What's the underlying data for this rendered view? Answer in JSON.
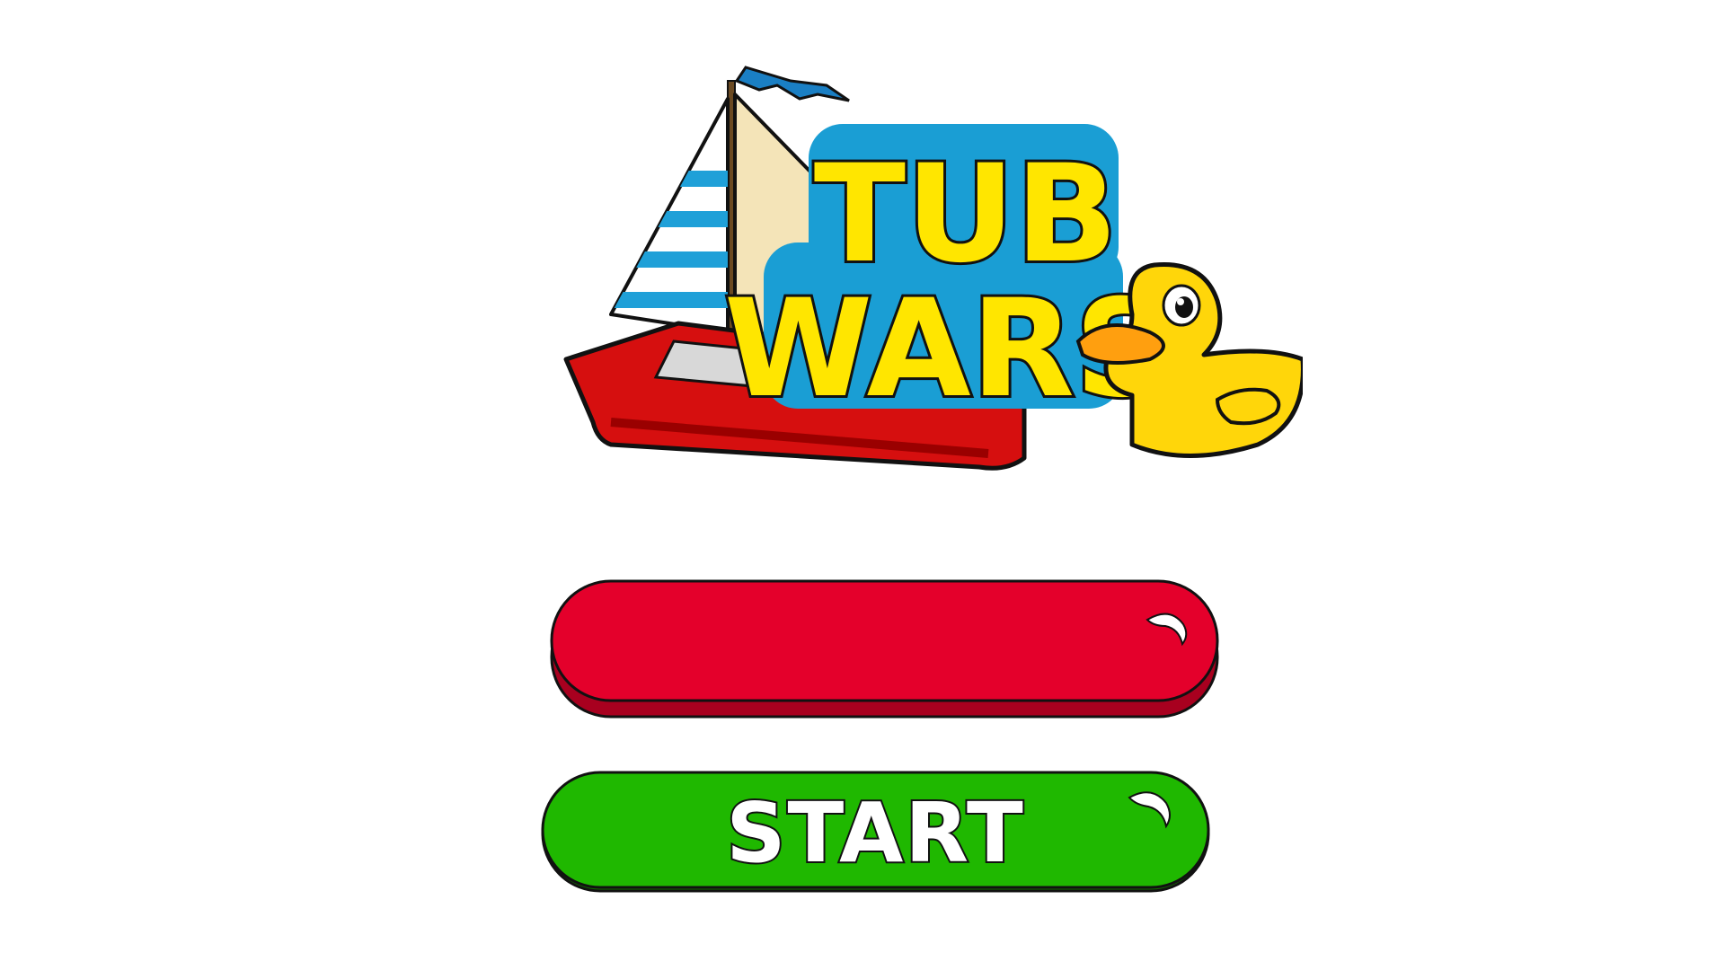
{
  "game": {
    "title_line1": "TUB",
    "title_line2": "WARS"
  },
  "buttons": {
    "top_label": "",
    "start_label": "START"
  },
  "colors": {
    "background": "#ffffff",
    "top_button": "#e4002b",
    "top_button_shadow": "#a8001f",
    "start_button": "#1fb800",
    "title_fill": "#ffe600",
    "title_outline": "#1a9ed4",
    "boat_hull": "#d60f0f",
    "duck_body": "#ffd60a",
    "duck_beak": "#ff9f0f"
  },
  "icons": {
    "boat": "sailboat-icon",
    "duck": "rubber-duck-icon"
  }
}
